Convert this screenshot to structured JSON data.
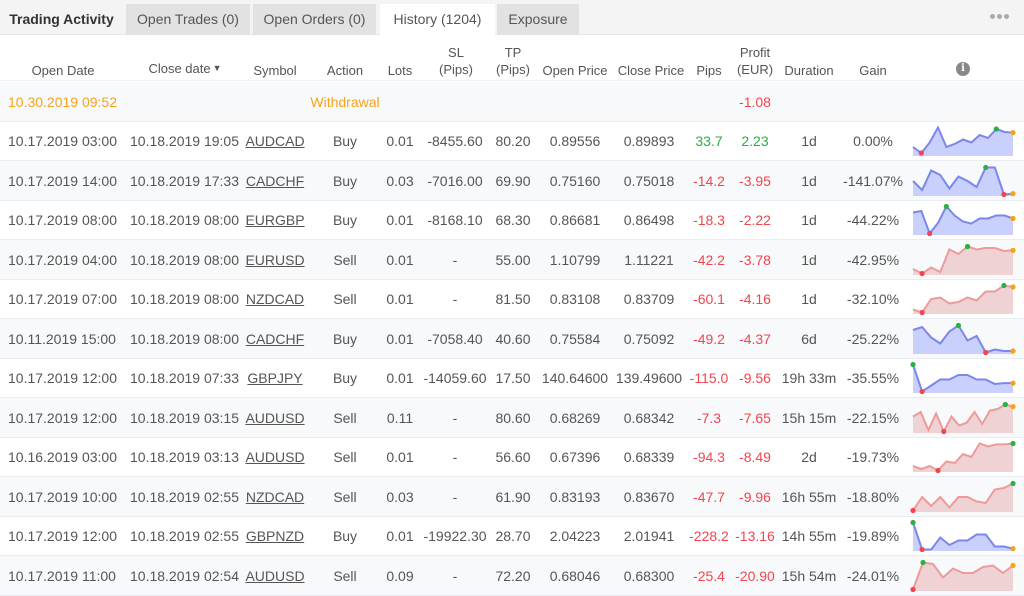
{
  "tabs": {
    "title": "Trading Activity",
    "items": [
      {
        "label": "Open Trades (0)"
      },
      {
        "label": "Open Orders (0)"
      },
      {
        "label": "History (1204)",
        "active": true
      },
      {
        "label": "Exposure"
      }
    ],
    "more_icon": "ellipsis-icon"
  },
  "columns": {
    "open_date": "Open Date",
    "close_date": "Close date",
    "sort_indicator": "▼",
    "symbol": "Symbol",
    "action": "Action",
    "lots": "Lots",
    "sl_1": "SL",
    "sl_2": "(Pips)",
    "tp_1": "TP",
    "tp_2": "(Pips)",
    "open_price": "Open Price",
    "close_price": "Close Price",
    "pips": "Pips",
    "profit_1": "Profit",
    "profit_2": "(EUR)",
    "duration": "Duration",
    "gain": "Gain",
    "info_icon": "i"
  },
  "colors": {
    "positive": "#2bb043",
    "negative": "#f2454f",
    "withdrawal": "#f7a21c",
    "spark_blue_line": "#7b86ee",
    "spark_blue_fill": "#c9d0fb",
    "spark_red_line": "#ee9a9a",
    "spark_red_fill": "#efd3d4"
  },
  "withdrawal": {
    "date": "10.30.2019 09:52",
    "label": "Withdrawal",
    "profit": "-1.08"
  },
  "rows": [
    {
      "open": "10.17.2019 03:00",
      "close": "10.18.2019 19:05",
      "symbol": "AUDCAD",
      "action": "Buy",
      "lots": "0.01",
      "sl": "-8455.60",
      "tp": "80.20",
      "open_price": "0.89556",
      "close_price": "0.89893",
      "pips": "33.7",
      "profit": "2.23",
      "duration": "1d",
      "gain": "0.00%",
      "trend": "blue",
      "spark": [
        0.3,
        0.1,
        0.45,
        0.95,
        0.3,
        0.4,
        0.55,
        0.45,
        0.7,
        0.6,
        0.9,
        0.8,
        0.78
      ],
      "max_i": 10,
      "min_i": 1
    },
    {
      "open": "10.17.2019 14:00",
      "close": "10.18.2019 17:33",
      "symbol": "CADCHF",
      "action": "Buy",
      "lots": "0.03",
      "sl": "-7016.00",
      "tp": "69.90",
      "open_price": "0.75160",
      "close_price": "0.75018",
      "pips": "-14.2",
      "profit": "-3.95",
      "duration": "1d",
      "gain": "-141.07%",
      "trend": "blue",
      "spark": [
        0.5,
        0.2,
        0.85,
        0.7,
        0.25,
        0.65,
        0.5,
        0.3,
        0.95,
        0.95,
        0.05,
        0.08
      ],
      "max_i": 8,
      "min_i": 10
    },
    {
      "open": "10.17.2019 08:00",
      "close": "10.18.2019 08:00",
      "symbol": "EURGBP",
      "action": "Buy",
      "lots": "0.01",
      "sl": "-8168.10",
      "tp": "68.30",
      "open_price": "0.86681",
      "close_price": "0.86498",
      "pips": "-18.3",
      "profit": "-2.22",
      "duration": "1d",
      "gain": "-44.22%",
      "trend": "blue",
      "spark": [
        0.75,
        0.8,
        0.05,
        0.4,
        0.95,
        0.65,
        0.45,
        0.38,
        0.55,
        0.55,
        0.65,
        0.65,
        0.55
      ],
      "max_i": 4,
      "min_i": 2
    },
    {
      "open": "10.17.2019 04:00",
      "close": "10.18.2019 08:00",
      "symbol": "EURUSD",
      "action": "Sell",
      "lots": "0.01",
      "sl": "-",
      "tp": "55.00",
      "open_price": "1.10799",
      "close_price": "1.11221",
      "pips": "-42.2",
      "profit": "-3.78",
      "duration": "1d",
      "gain": "-42.95%",
      "trend": "red",
      "spark": [
        0.2,
        0.05,
        0.25,
        0.1,
        0.85,
        0.7,
        0.95,
        0.85,
        0.9,
        0.9,
        0.8,
        0.82
      ],
      "max_i": 6,
      "min_i": 1
    },
    {
      "open": "10.17.2019 07:00",
      "close": "10.18.2019 08:00",
      "symbol": "NZDCAD",
      "action": "Sell",
      "lots": "0.01",
      "sl": "-",
      "tp": "81.50",
      "open_price": "0.83108",
      "close_price": "0.83709",
      "pips": "-60.1",
      "profit": "-4.16",
      "duration": "1d",
      "gain": "-32.10%",
      "trend": "red",
      "spark": [
        0.15,
        0.05,
        0.5,
        0.55,
        0.35,
        0.4,
        0.55,
        0.45,
        0.75,
        0.75,
        0.95,
        0.9
      ],
      "max_i": 10,
      "min_i": 1
    },
    {
      "open": "10.11.2019 15:00",
      "close": "10.18.2019 08:00",
      "symbol": "CADCHF",
      "action": "Buy",
      "lots": "0.01",
      "sl": "-7058.40",
      "tp": "40.60",
      "open_price": "0.75584",
      "close_price": "0.75092",
      "pips": "-49.2",
      "profit": "-4.37",
      "duration": "6d",
      "gain": "-25.22%",
      "trend": "blue",
      "spark": [
        0.8,
        0.9,
        0.55,
        0.35,
        0.75,
        0.95,
        0.45,
        0.6,
        0.05,
        0.15,
        0.1,
        0.1
      ],
      "max_i": 5,
      "min_i": 8
    },
    {
      "open": "10.17.2019 12:00",
      "close": "10.18.2019 07:33",
      "symbol": "GBPJPY",
      "action": "Buy",
      "lots": "0.01",
      "sl": "-14059.60",
      "tp": "17.50",
      "open_price": "140.64600",
      "close_price": "139.49600",
      "pips": "-115.0",
      "profit": "-9.56",
      "duration": "19h 33m",
      "gain": "-35.55%",
      "trend": "blue",
      "spark": [
        0.95,
        0.05,
        0.25,
        0.45,
        0.45,
        0.6,
        0.6,
        0.45,
        0.45,
        0.3,
        0.33,
        0.33
      ],
      "max_i": 0,
      "min_i": 1
    },
    {
      "open": "10.17.2019 12:00",
      "close": "10.18.2019 03:15",
      "symbol": "AUDUSD",
      "action": "Sell",
      "lots": "0.11",
      "sl": "-",
      "tp": "80.60",
      "open_price": "0.68269",
      "close_price": "0.68342",
      "pips": "-7.3",
      "profit": "-7.65",
      "duration": "15h 15m",
      "gain": "-22.15%",
      "trend": "red",
      "spark": [
        0.55,
        0.7,
        0.1,
        0.65,
        0.05,
        0.55,
        0.25,
        0.35,
        0.7,
        0.3,
        0.75,
        0.8,
        0.95,
        0.88
      ],
      "max_i": 12,
      "min_i": 4
    },
    {
      "open": "10.16.2019 03:00",
      "close": "10.18.2019 03:13",
      "symbol": "AUDUSD",
      "action": "Sell",
      "lots": "0.01",
      "sl": "-",
      "tp": "56.60",
      "open_price": "0.67396",
      "close_price": "0.68339",
      "pips": "-94.3",
      "profit": "-8.49",
      "duration": "2d",
      "gain": "-19.73%",
      "trend": "red",
      "spark": [
        0.2,
        0.1,
        0.2,
        0.05,
        0.35,
        0.3,
        0.6,
        0.5,
        0.95,
        0.85,
        0.92,
        0.92,
        0.95
      ],
      "max_i": 12,
      "min_i": 3
    },
    {
      "open": "10.17.2019 10:00",
      "close": "10.18.2019 02:55",
      "symbol": "NZDCAD",
      "action": "Sell",
      "lots": "0.03",
      "sl": "-",
      "tp": "61.90",
      "open_price": "0.83193",
      "close_price": "0.83670",
      "pips": "-47.7",
      "profit": "-9.96",
      "duration": "16h 55m",
      "gain": "-18.80%",
      "trend": "red",
      "spark": [
        0.05,
        0.5,
        0.2,
        0.5,
        0.15,
        0.5,
        0.5,
        0.35,
        0.3,
        0.75,
        0.8,
        0.95
      ],
      "max_i": 11,
      "min_i": 0
    },
    {
      "open": "10.17.2019 12:00",
      "close": "10.18.2019 02:55",
      "symbol": "GBPNZD",
      "action": "Buy",
      "lots": "0.01",
      "sl": "-19922.30",
      "tp": "28.70",
      "open_price": "2.04223",
      "close_price": "2.01941",
      "pips": "-228.2",
      "profit": "-13.16",
      "duration": "14h 55m",
      "gain": "-19.89%",
      "trend": "blue",
      "spark": [
        0.95,
        0.05,
        0.05,
        0.45,
        0.2,
        0.35,
        0.35,
        0.55,
        0.55,
        0.15,
        0.15,
        0.08
      ],
      "max_i": 0,
      "min_i": 1
    },
    {
      "open": "10.17.2019 11:00",
      "close": "10.18.2019 02:54",
      "symbol": "AUDUSD",
      "action": "Sell",
      "lots": "0.09",
      "sl": "-",
      "tp": "72.20",
      "open_price": "0.68046",
      "close_price": "0.68300",
      "pips": "-25.4",
      "profit": "-20.90",
      "duration": "15h 54m",
      "gain": "-24.01%",
      "trend": "red",
      "spark": [
        0.05,
        0.95,
        0.9,
        0.45,
        0.75,
        0.6,
        0.6,
        0.8,
        0.85,
        0.6,
        0.85
      ],
      "max_i": 1,
      "min_i": 0
    }
  ]
}
